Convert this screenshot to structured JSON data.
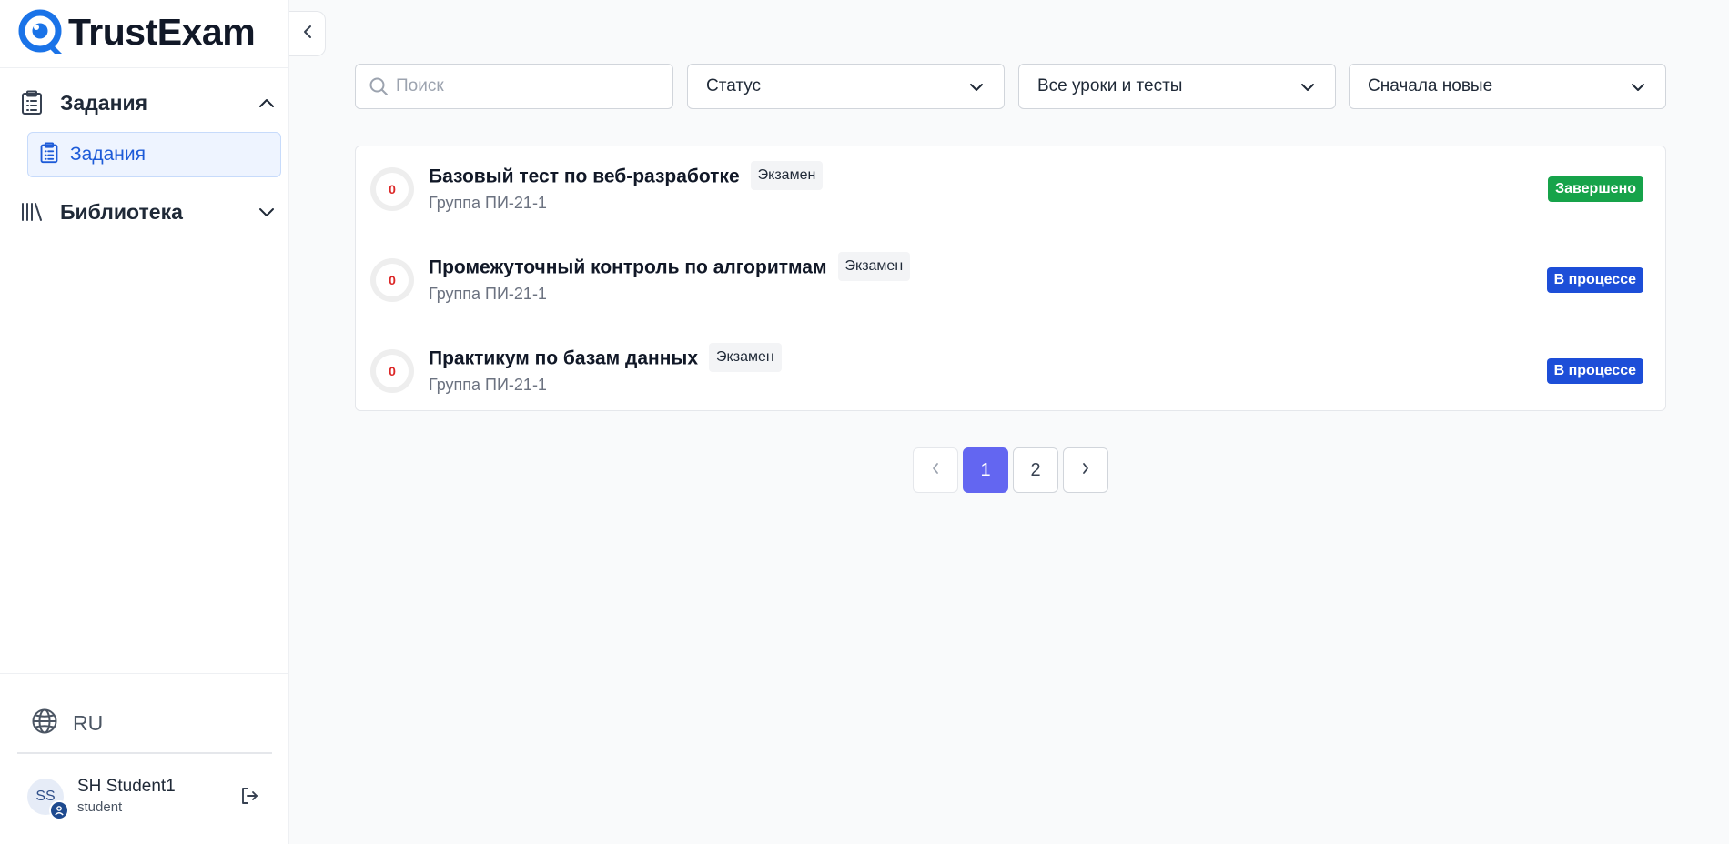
{
  "brand": {
    "name": "TrustExam",
    "color": "#1a73e8"
  },
  "sidebar": {
    "groups": [
      {
        "label": "Задания",
        "icon": "clipboard-icon",
        "expanded": true,
        "items": [
          {
            "label": "Задания",
            "icon": "clipboard-icon",
            "active": true
          }
        ]
      },
      {
        "label": "Библиотека",
        "icon": "library-icon",
        "expanded": false
      }
    ],
    "language": {
      "label": "RU",
      "icon": "globe-icon"
    },
    "user": {
      "initials": "SS",
      "name": "SH Student1",
      "role": "student"
    }
  },
  "filters": {
    "search": {
      "placeholder": "Поиск",
      "value": ""
    },
    "status": {
      "value": "Статус"
    },
    "lessons": {
      "value": "Все уроки и тесты"
    },
    "sort": {
      "value": "Сначала новые"
    }
  },
  "tasks": [
    {
      "score": "0",
      "title": "Базовый тест по веб-разработке",
      "tag": "Экзамен",
      "group": "Группа ПИ-21-1",
      "status": "Завершено",
      "status_color": "#16a34a"
    },
    {
      "score": "0",
      "title": "Промежуточный контроль по алгоритмам",
      "tag": "Экзамен",
      "group": "Группа ПИ-21-1",
      "status": "В процессе",
      "status_color": "#1d4ed8"
    },
    {
      "score": "0",
      "title": "Практикум по базам данных",
      "tag": "Экзамен",
      "group": "Группа ПИ-21-1",
      "status": "В процессе",
      "status_color": "#1d4ed8"
    }
  ],
  "pagination": {
    "pages": [
      "1",
      "2"
    ],
    "current": "1"
  }
}
